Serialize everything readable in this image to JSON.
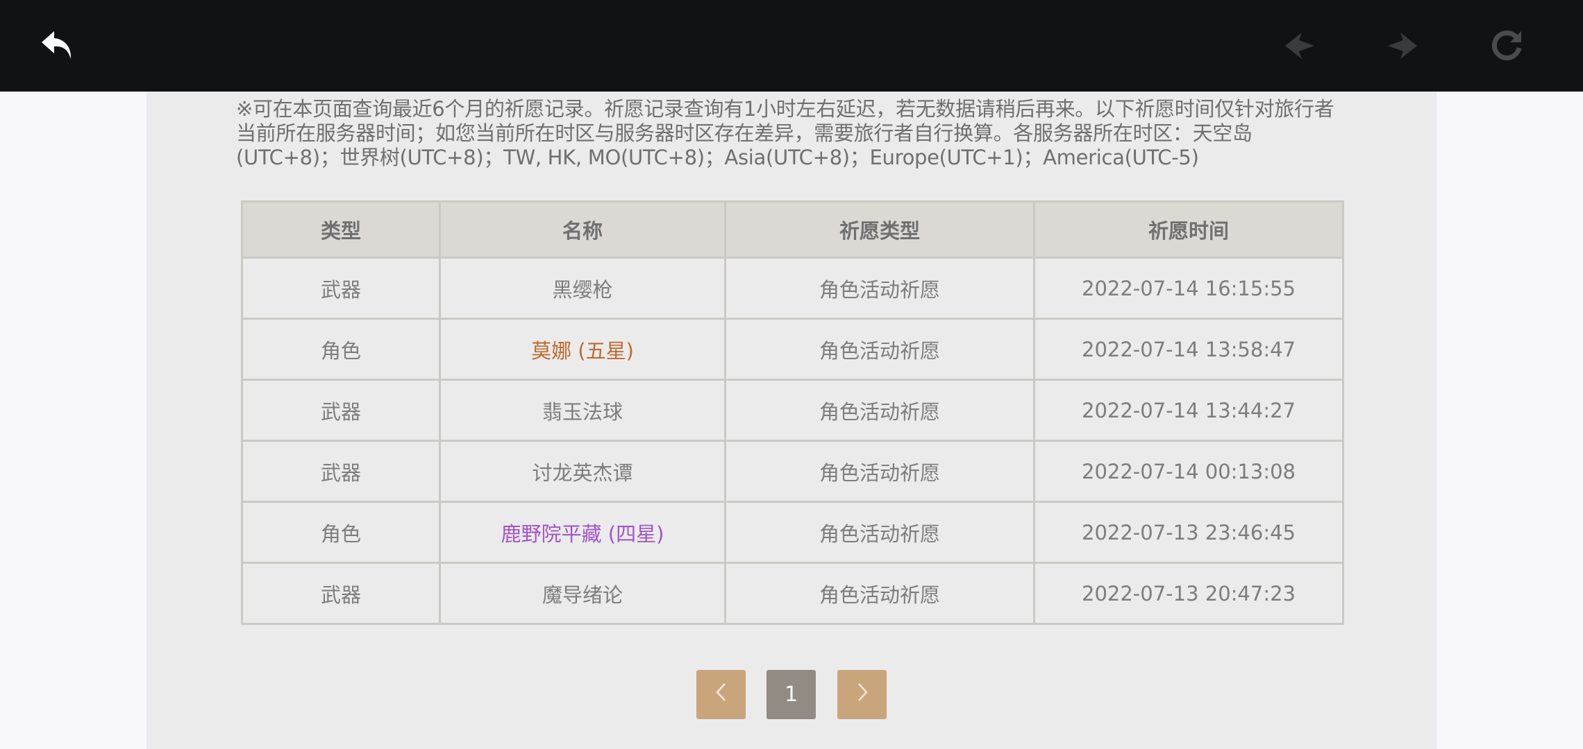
{
  "topbar": {
    "back_icon": "back-arrow-icon",
    "prev_icon": "prev-diamond-icon",
    "next_icon": "next-diamond-icon",
    "refresh_icon": "refresh-icon"
  },
  "notice": "※可在本页面查询最近6个月的祈愿记录。祈愿记录查询有1小时左右延迟，若无数据请稍后再来。以下祈愿时间仅针对旅行者当前所在服务器时间；如您当前所在时区与服务器时区存在差异，需要旅行者自行换算。各服务器所在时区：天空岛(UTC+8)；世界树(UTC+8)；TW, HK, MO(UTC+8)；Asia(UTC+8)；Europe(UTC+1)；America(UTC-5)",
  "table": {
    "headers": [
      "类型",
      "名称",
      "祈愿类型",
      "祈愿时间"
    ],
    "rows": [
      {
        "type": "武器",
        "name": "黑缨枪",
        "wish_type": "角色活动祈愿",
        "time": "2022-07-14 16:15:55",
        "name_color": "#7d7d7d"
      },
      {
        "type": "角色",
        "name": "莫娜 (五星)",
        "wish_type": "角色活动祈愿",
        "time": "2022-07-14 13:58:47",
        "name_color": "#c06a2c"
      },
      {
        "type": "武器",
        "name": "翡玉法球",
        "wish_type": "角色活动祈愿",
        "time": "2022-07-14 13:44:27",
        "name_color": "#7d7d7d"
      },
      {
        "type": "武器",
        "name": "讨龙英杰谭",
        "wish_type": "角色活动祈愿",
        "time": "2022-07-14 00:13:08",
        "name_color": "#7d7d7d"
      },
      {
        "type": "角色",
        "name": "鹿野院平藏 (四星)",
        "wish_type": "角色活动祈愿",
        "time": "2022-07-13 23:46:45",
        "name_color": "#a256c8"
      },
      {
        "type": "武器",
        "name": "魔导绪论",
        "wish_type": "角色活动祈愿",
        "time": "2022-07-13 20:47:23",
        "name_color": "#7d7d7d"
      }
    ]
  },
  "pagination": {
    "prev_icon": "chevron-left-icon",
    "current_page": "1",
    "next_icon": "chevron-right-icon"
  }
}
